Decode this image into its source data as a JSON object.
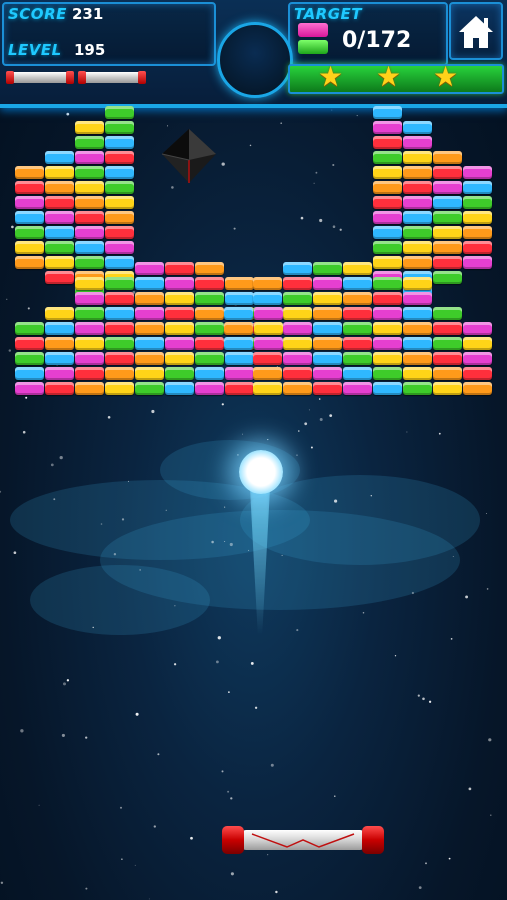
{
  "hud": {
    "score_label": "SCORE",
    "score_value": "231",
    "level_label": "LEVEL",
    "level_value": "195",
    "target_label": "TARGET",
    "target_value": "0/172",
    "lives_remaining": 2,
    "stars_earned": 3,
    "home_icon": "home-icon"
  },
  "colors": {
    "hud_accent": "#1fc9ff",
    "star": "#ffd21a",
    "star_bar": "#28d23c",
    "ball_glow": "#9fe4ff",
    "paddle_cap": "#e01010",
    "brick_palette": {
      "red": "#ff2f3c",
      "orange": "#ff9a1a",
      "yellow": "#ffd418",
      "green": "#3ecc2a",
      "cyan": "#2fb8ff",
      "magenta": "#e63fd0"
    }
  },
  "playfield": {
    "enemy": "black-octahedron",
    "ball": "glowing-ball",
    "paddle": "paddle"
  }
}
